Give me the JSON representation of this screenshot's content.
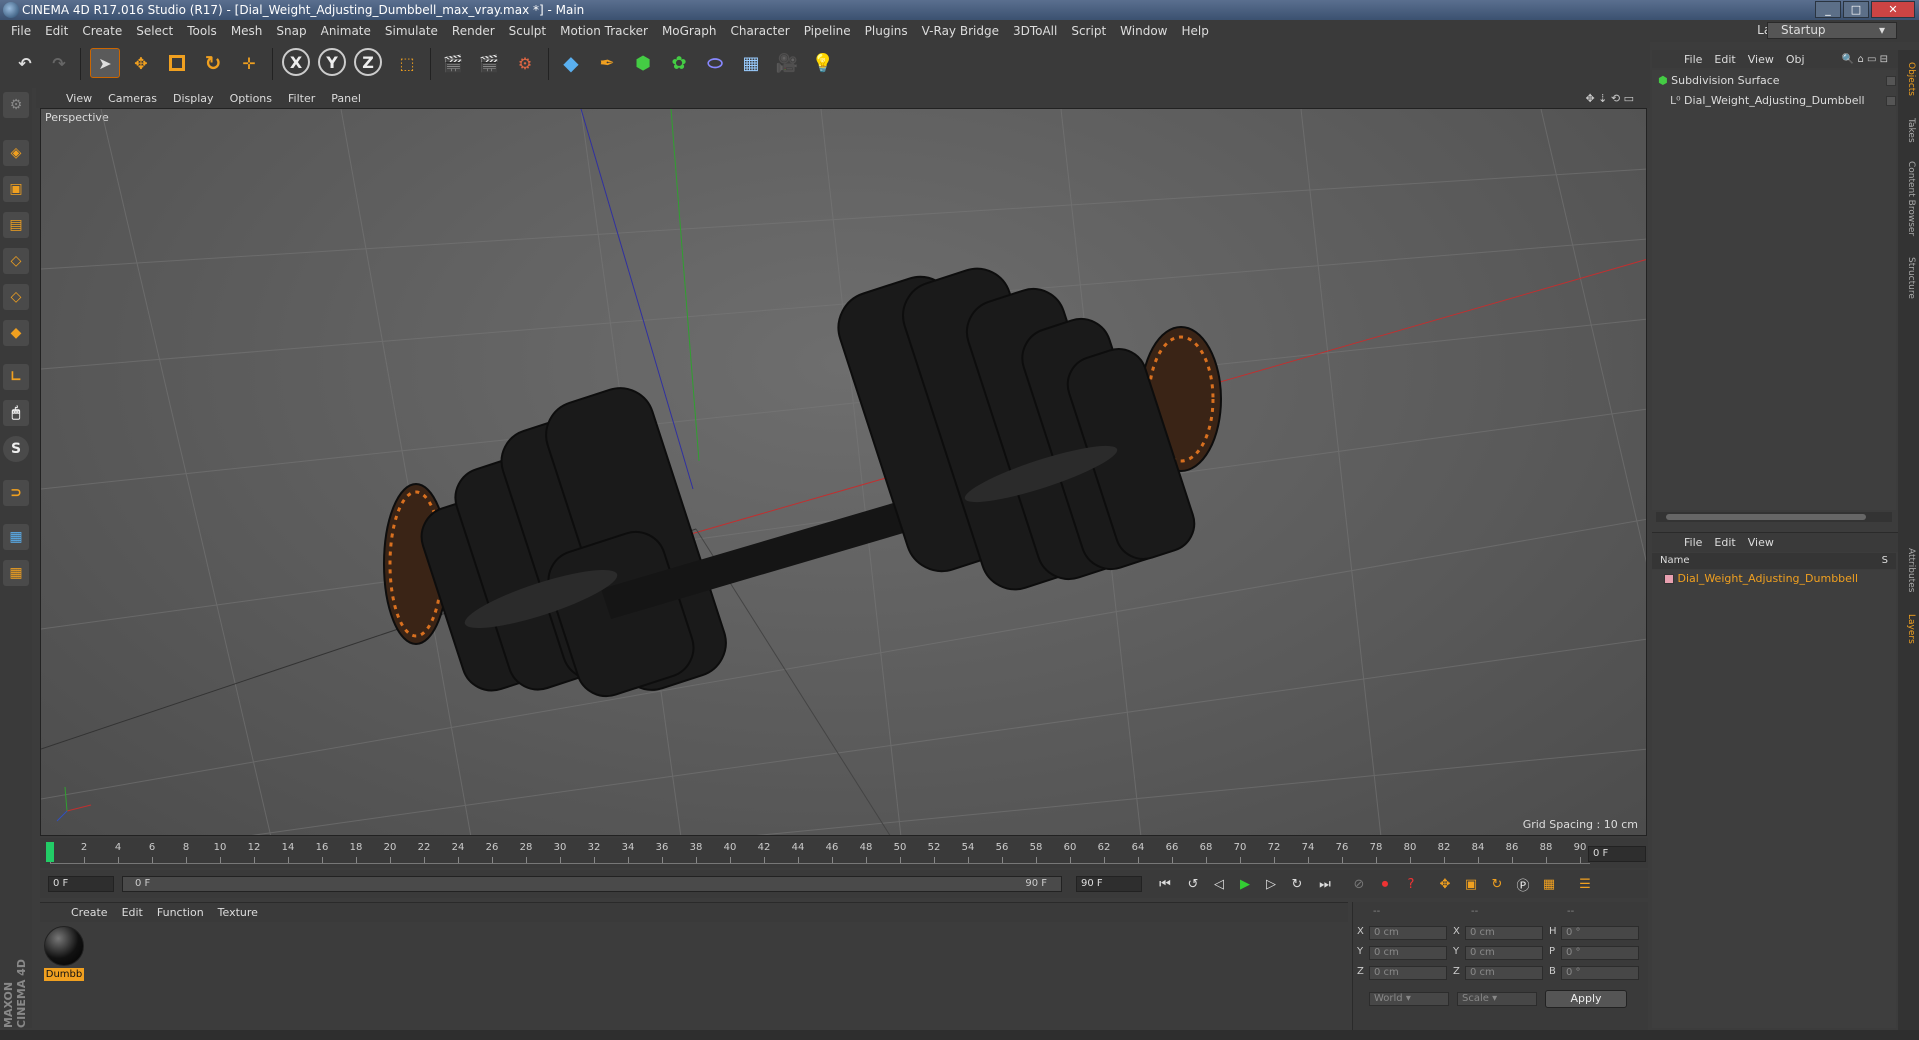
{
  "window": {
    "title": "CINEMA 4D R17.016 Studio (R17) - [Dial_Weight_Adjusting_Dumbbell_max_vray.max *] - Main"
  },
  "menubar": {
    "items": [
      "File",
      "Edit",
      "Create",
      "Select",
      "Tools",
      "Mesh",
      "Snap",
      "Animate",
      "Simulate",
      "Render",
      "Sculpt",
      "Motion Tracker",
      "MoGraph",
      "Character",
      "Pipeline",
      "Plugins",
      "V-Ray Bridge",
      "3DToAll",
      "Script",
      "Window",
      "Help"
    ],
    "layout_label": "Layout:",
    "layout_value": "Startup"
  },
  "toolbar": {
    "axis_x": "X",
    "axis_y": "Y",
    "axis_z": "Z"
  },
  "viewport": {
    "menu": [
      "View",
      "Cameras",
      "Display",
      "Options",
      "Filter",
      "Panel"
    ],
    "label": "Perspective",
    "grid_spacing": "Grid Spacing : 10 cm"
  },
  "timeline": {
    "ticks": [
      "0",
      "2",
      "4",
      "6",
      "8",
      "10",
      "12",
      "14",
      "16",
      "18",
      "20",
      "22",
      "24",
      "26",
      "28",
      "30",
      "32",
      "34",
      "36",
      "38",
      "40",
      "42",
      "44",
      "46",
      "48",
      "50",
      "52",
      "54",
      "56",
      "58",
      "60",
      "62",
      "64",
      "66",
      "68",
      "70",
      "72",
      "74",
      "76",
      "78",
      "80",
      "82",
      "84",
      "86",
      "88",
      "90"
    ],
    "current_frame": "0 F",
    "start_field": "0 F",
    "range_start": "0 F",
    "range_end": "90 F",
    "end_field": "90 F"
  },
  "material_manager": {
    "menu": [
      "Create",
      "Edit",
      "Function",
      "Texture"
    ],
    "material_label": "Dumbb"
  },
  "coordinates": {
    "header": [
      "--",
      "--",
      "--"
    ],
    "rows": [
      {
        "a": "X",
        "a_val": "0 cm",
        "b": "X",
        "b_val": "0 cm",
        "c": "H",
        "c_val": "0 °"
      },
      {
        "a": "Y",
        "a_val": "0 cm",
        "b": "Y",
        "b_val": "0 cm",
        "c": "P",
        "c_val": "0 °"
      },
      {
        "a": "Z",
        "a_val": "0 cm",
        "b": "Z",
        "b_val": "0 cm",
        "c": "B",
        "c_val": "0 °"
      }
    ],
    "mode": "World",
    "transform": "Scale",
    "apply": "Apply"
  },
  "object_manager": {
    "menu": [
      "File",
      "Edit",
      "View",
      "Obj"
    ],
    "items": [
      "Subdivision Surface",
      "Dial_Weight_Adjusting_Dumbbell"
    ]
  },
  "layer_manager": {
    "menu": [
      "File",
      "Edit",
      "View"
    ],
    "col_name": "Name",
    "col_s": "S",
    "items": [
      "Dial_Weight_Adjusting_Dumbbell"
    ]
  },
  "side_tabs": [
    "Objects",
    "Takes",
    "Content Browser",
    "Structure",
    "Attributes",
    "Layers"
  ],
  "branding": "MAXON CINEMA 4D",
  "colors": {
    "accent": "#f0a020",
    "active_frame": "#22cc66",
    "layer_item": "#f0a020"
  }
}
